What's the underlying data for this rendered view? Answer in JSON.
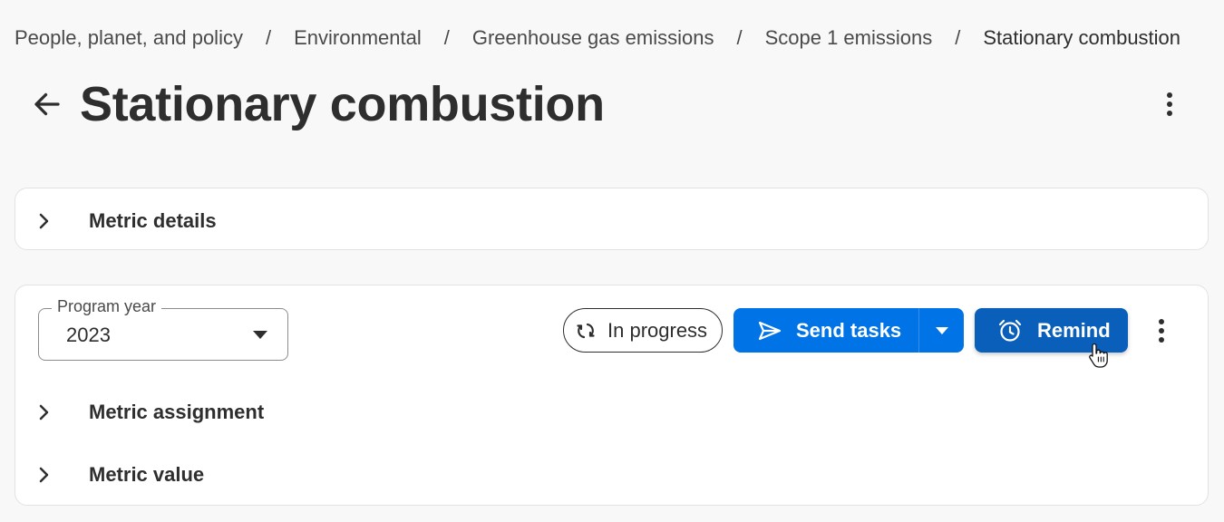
{
  "breadcrumb": {
    "items": [
      "People, planet, and policy",
      "Environmental",
      "Greenhouse gas emissions",
      "Scope 1 emissions"
    ],
    "current": "Stationary combustion",
    "separator": "/"
  },
  "header": {
    "title": "Stationary combustion",
    "back_icon": "arrow-left-icon",
    "menu_icon": "more-vertical-icon"
  },
  "metric_details": {
    "label": "Metric details",
    "expanded": false
  },
  "program": {
    "select": {
      "label": "Program year",
      "value": "2023"
    },
    "status": {
      "label": "In progress",
      "icon": "sync-icon"
    },
    "send_tasks": {
      "label": "Send tasks",
      "icon": "send-icon"
    },
    "remind": {
      "label": "Remind",
      "icon": "alarm-clock-icon"
    },
    "sections": [
      {
        "label": "Metric assignment",
        "expanded": false
      },
      {
        "label": "Metric value",
        "expanded": false
      }
    ]
  },
  "colors": {
    "primary": "#0073e6",
    "primary_hover": "#0a5fba",
    "text": "#2e2e2e",
    "background": "#f8f8f8"
  }
}
